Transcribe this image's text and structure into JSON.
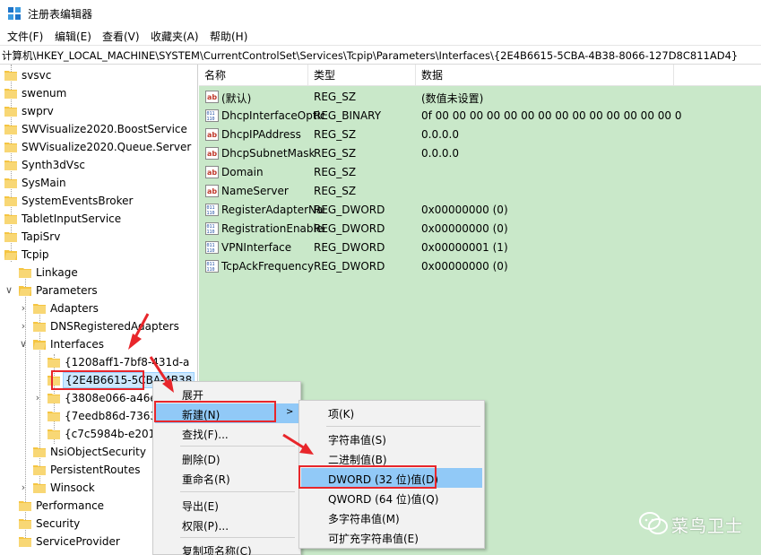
{
  "window": {
    "title": "注册表编辑器"
  },
  "menu": [
    "文件(F)",
    "编辑(E)",
    "查看(V)",
    "收藏夹(A)",
    "帮助(H)"
  ],
  "address": "计算机\\HKEY_LOCAL_MACHINE\\SYSTEM\\CurrentControlSet\\Services\\Tcpip\\Parameters\\Interfaces\\{2E4B6615-5CBA-4B38-8066-127D8C811AD4}",
  "tree": [
    "svsvc",
    "swenum",
    "swprv",
    "SWVisualize2020.BoostService",
    "SWVisualize2020.Queue.Server",
    "Synth3dVsc",
    "SysMain",
    "SystemEventsBroker",
    "TabletInputService",
    "TapiSrv",
    "Tcpip",
    "Linkage",
    "Parameters",
    "Adapters",
    "DNSRegisteredAdapters",
    "Interfaces",
    "{1208aff1-7bf8-431d-a",
    "{2E4B6615-5CBA-4B38",
    "{3808e066-a46e-",
    "{7eedb86d-7363",
    "{c7c5984b-e201-",
    "NsiObjectSecurity",
    "PersistentRoutes",
    "Winsock",
    "Performance",
    "Security",
    "ServiceProvider"
  ],
  "list": {
    "headers": [
      "名称",
      "类型",
      "数据"
    ],
    "rows": [
      {
        "name": "(默认)",
        "type": "REG_SZ",
        "data": "(数值未设置)",
        "icon": "string-value-icon"
      },
      {
        "name": "DhcpInterfaceOptions",
        "type": "REG_BINARY",
        "data": "0f 00 00 00 00 00 00 00 00 00 00 00 00 00 00 00 ...",
        "icon": "binary-value-icon"
      },
      {
        "name": "DhcpIPAddress",
        "type": "REG_SZ",
        "data": "0.0.0.0",
        "icon": "string-value-icon"
      },
      {
        "name": "DhcpSubnetMask",
        "type": "REG_SZ",
        "data": "0.0.0.0",
        "icon": "string-value-icon"
      },
      {
        "name": "Domain",
        "type": "REG_SZ",
        "data": "",
        "icon": "string-value-icon"
      },
      {
        "name": "NameServer",
        "type": "REG_SZ",
        "data": "",
        "icon": "string-value-icon"
      },
      {
        "name": "RegisterAdapterName",
        "type": "REG_DWORD",
        "data": "0x00000000 (0)",
        "icon": "binary-value-icon"
      },
      {
        "name": "RegistrationEnabled",
        "type": "REG_DWORD",
        "data": "0x00000000 (0)",
        "icon": "binary-value-icon"
      },
      {
        "name": "VPNInterface",
        "type": "REG_DWORD",
        "data": "0x00000001 (1)",
        "icon": "binary-value-icon"
      },
      {
        "name": "TcpAckFrequency",
        "type": "REG_DWORD",
        "data": "0x00000000 (0)",
        "icon": "binary-value-icon"
      }
    ]
  },
  "context_menu": {
    "items": [
      "展开",
      "新建(N)",
      "查找(F)...",
      "删除(D)",
      "重命名(R)",
      "导出(E)",
      "权限(P)...",
      "复制项名称(C)"
    ]
  },
  "submenu": {
    "items": [
      "项(K)",
      "字符串值(S)",
      "二进制值(B)",
      "DWORD (32 位)值(D)",
      "QWORD (64 位)值(Q)",
      "多字符串值(M)",
      "可扩充字符串值(E)"
    ]
  },
  "watermark": "菜鸟卫士",
  "colors": {
    "list_bg": "#c9e8c9",
    "highlight": "#91c9f7",
    "annotation_red": "#e8262b",
    "folder": "#f5c542"
  }
}
